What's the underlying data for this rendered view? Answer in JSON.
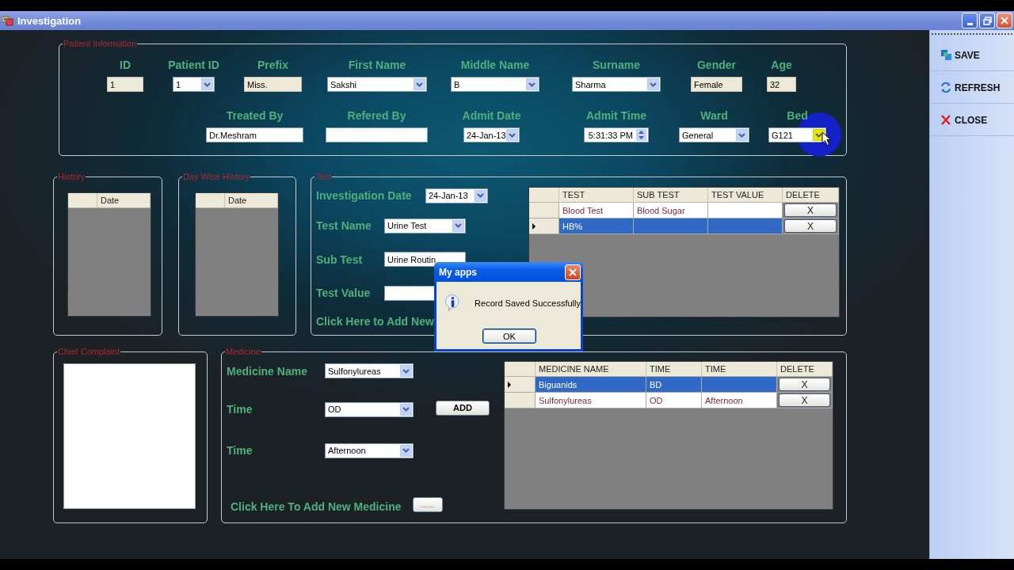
{
  "window": {
    "title": "Investigation"
  },
  "patient_information": {
    "title": "Patient Information",
    "field_rows": [
      [
        {
          "label": "ID",
          "kind": "readonly",
          "value": "1"
        },
        {
          "label": "Patient ID",
          "kind": "combo",
          "value": "1",
          "hovered": false
        },
        {
          "label": "Prefix",
          "kind": "readonly",
          "value": "Miss."
        },
        {
          "label": "First Name",
          "kind": "combo",
          "value": "Sakshi",
          "hovered": false
        },
        {
          "label": "Middle Name",
          "kind": "combo",
          "value": "B",
          "hovered": false
        },
        {
          "label": "Surname",
          "kind": "combo",
          "value": "Sharma",
          "hovered": false
        },
        {
          "label": "Gender",
          "kind": "readonly",
          "value": "Female"
        },
        {
          "label": "Age",
          "kind": "readonly",
          "value": "32"
        }
      ],
      [
        {
          "label": "Treated By",
          "kind": "text",
          "value": "Dr.Meshram"
        },
        {
          "label": "Refered By",
          "kind": "text"
        },
        {
          "label": "Admit Date",
          "kind": "combo",
          "value": "24-Jan-13",
          "hovered": false
        },
        {
          "label": "Admit Time",
          "kind": "spin",
          "value": "5:31:33 PM"
        },
        {
          "label": "Ward",
          "kind": "combo",
          "value": "General",
          "hovered": false
        },
        {
          "label": "Bed",
          "kind": "combo",
          "value": "G121",
          "hovered": true
        }
      ]
    ]
  },
  "history": {
    "title": "History",
    "columns": [
      "Date"
    ]
  },
  "day_wise_history": {
    "title": "Day Wise History",
    "columns": [
      "Date"
    ]
  },
  "test": {
    "title": "Test",
    "fields": [
      {
        "label": "Investigation Date",
        "kind": "combo",
        "value": "24-Jan-13"
      },
      {
        "label": "Test Name",
        "kind": "combo",
        "value": "Urine Test"
      },
      {
        "label": "Sub Test",
        "kind": "text",
        "value": "Urine Routin"
      },
      {
        "label": "Test Value",
        "kind": "text"
      }
    ],
    "add_link": "Click Here to Add New",
    "table": {
      "columns": [
        "TEST",
        "SUB TEST",
        "TEST VALUE",
        "DELETE"
      ],
      "rows": [
        {
          "test": "Blood Test",
          "sub_test": "Blood Sugar",
          "delete": "X",
          "selected": false
        },
        {
          "test": "HB%",
          "delete": "X",
          "selected": true
        }
      ]
    }
  },
  "chief_complaint": {
    "title": "Chief Complaint"
  },
  "medicine": {
    "title": "Medicine",
    "fields": [
      {
        "label": "Medicine Name",
        "kind": "combo",
        "value": "Sulfonylureas"
      },
      {
        "label": "Time",
        "kind": "combo",
        "value": "OD"
      },
      {
        "label": "Time",
        "kind": "combo",
        "value": "Afternoon"
      }
    ],
    "add_button": "ADD",
    "add_link": "Click Here To Add New Medicine",
    "browse_button": "......",
    "table": {
      "columns": [
        "MEDICINE NAME",
        "TIME",
        "TIME",
        "DELETE"
      ],
      "rows": [
        {
          "medicine_name": "Biguanids",
          "time": "BD",
          "delete": "X",
          "selected": true
        },
        {
          "medicine_name": "Sulfonylureas",
          "time": "OD",
          "time_2": "Afternoon",
          "delete": "X",
          "selected": false
        }
      ]
    }
  },
  "toolbar": [
    {
      "label": "SAVE",
      "kind": "save"
    },
    {
      "label": "REFRESH",
      "kind": "refresh"
    },
    {
      "label": "CLOSE",
      "kind": "close"
    }
  ],
  "dialog": {
    "title": "My apps",
    "message": "Record Saved Successfully",
    "button": "OK"
  }
}
